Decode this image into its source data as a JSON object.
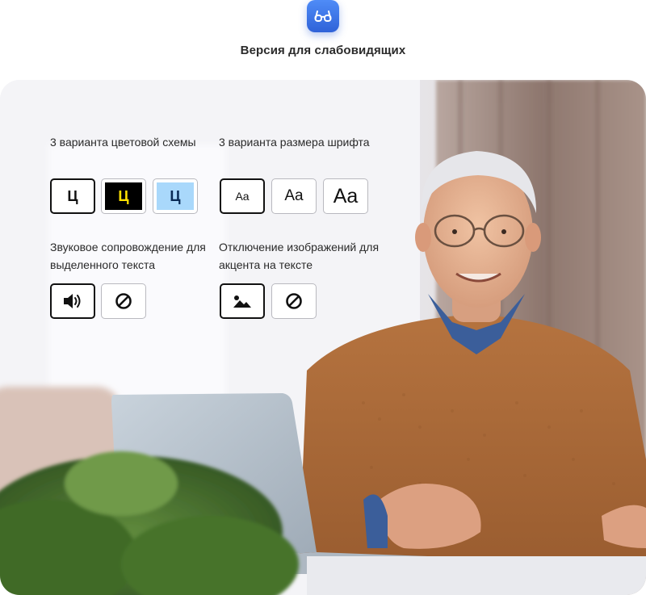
{
  "header": {
    "icon": "glasses-icon",
    "title": "Версия для слабовидящих",
    "accent": "#3a6fe3"
  },
  "color_scheme": {
    "label": "3 варианта цветовой схемы",
    "options": [
      {
        "glyph": "Ц",
        "name": "white",
        "bg": "#ffffff",
        "fg": "#111111",
        "active": true
      },
      {
        "glyph": "Ц",
        "name": "black",
        "bg": "#000000",
        "fg": "#ffe100",
        "active": false
      },
      {
        "glyph": "Ц",
        "name": "blue",
        "bg": "#a9d8fb",
        "fg": "#0a2a55",
        "active": false
      }
    ]
  },
  "font_size": {
    "label": "3 варианта размера шрифта",
    "options": [
      {
        "glyph": "Aa",
        "name": "small",
        "active": true
      },
      {
        "glyph": "Aa",
        "name": "medium",
        "active": false
      },
      {
        "glyph": "Aa",
        "name": "large",
        "active": false
      }
    ]
  },
  "sound": {
    "label": "Звуковое сопровождение для выделенного текста",
    "options": [
      {
        "icon": "speaker-icon",
        "active": true
      },
      {
        "icon": "disabled-icon",
        "active": false
      }
    ]
  },
  "images": {
    "label": "Отключение изображений для акцента на тексте",
    "options": [
      {
        "icon": "image-icon",
        "active": true
      },
      {
        "icon": "disabled-icon",
        "active": false
      }
    ]
  },
  "photo": {
    "description_icon": "photo-illustration"
  }
}
